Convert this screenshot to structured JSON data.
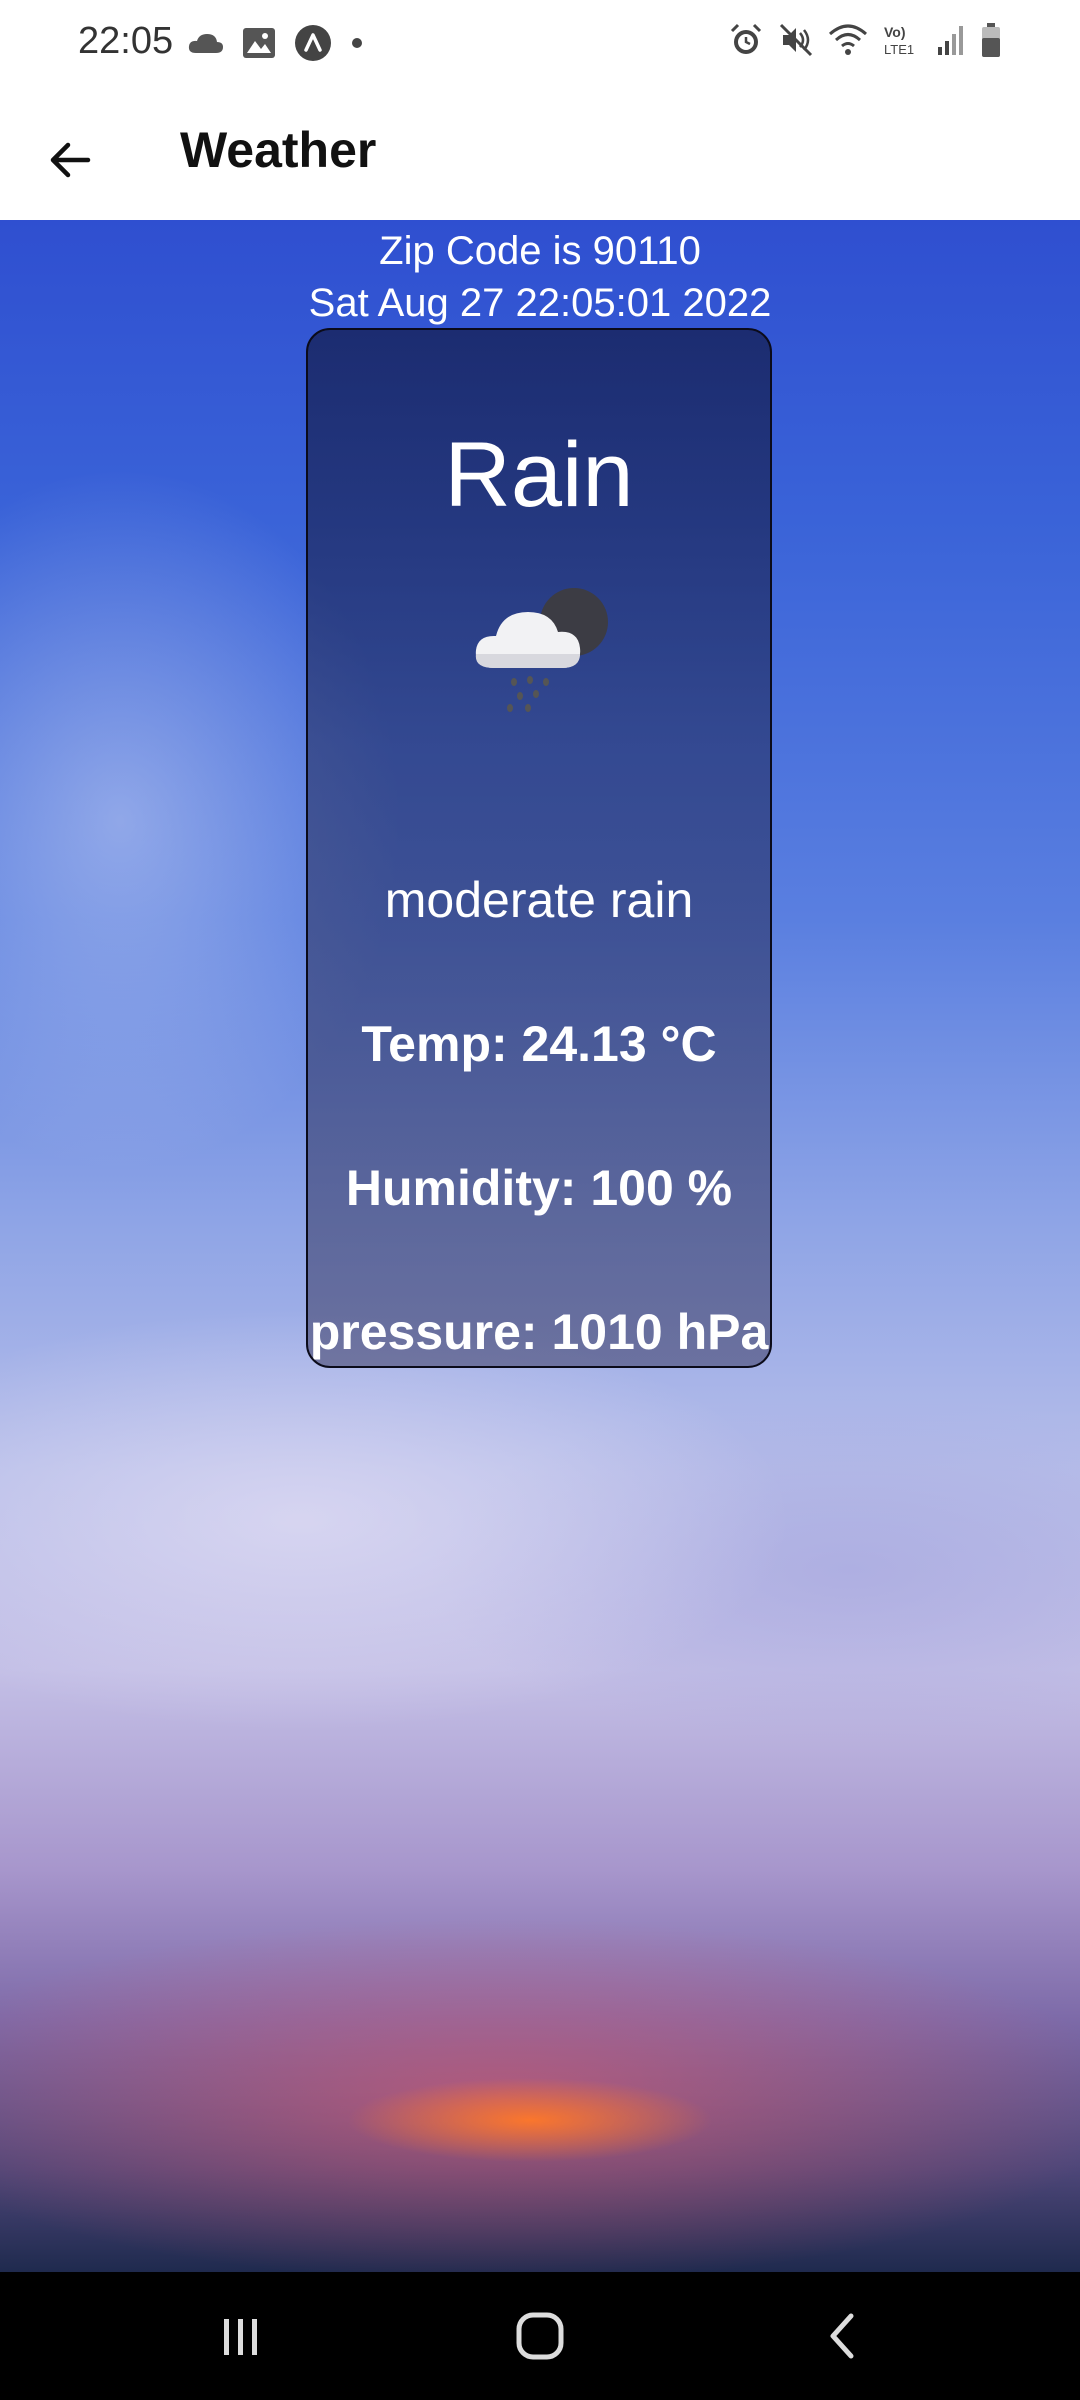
{
  "status_bar": {
    "time": "22:05",
    "left_icons": [
      "cloud-icon",
      "image-icon",
      "app-icon",
      "dot-icon"
    ],
    "right_icons": [
      "alarm-icon",
      "mute-icon",
      "wifi-icon",
      "volte-icon",
      "signal-icon",
      "battery-icon"
    ],
    "volte_label": "Vo) LTE1"
  },
  "app_bar": {
    "title": "Weather",
    "back_icon": "arrow-left-icon"
  },
  "weather": {
    "zip_line": "Zip Code is 90110",
    "date_line": "Sat Aug 27 22:05:01 2022",
    "main": "Rain",
    "icon": "cloud-rain-moon-icon",
    "description": "moderate rain",
    "temp_line": "Temp: 24.13 °C",
    "humidity_line": "Humidity: 100 %",
    "pressure_line": "pressure: 1010 hPa"
  },
  "nav_bar": {
    "recent_icon": "recent-apps-icon",
    "home_icon": "home-icon",
    "back_icon": "back-icon"
  },
  "colors": {
    "card_border": "#0b0b1a",
    "text_on_sky": "#ffffff",
    "nav_background": "#000000"
  }
}
